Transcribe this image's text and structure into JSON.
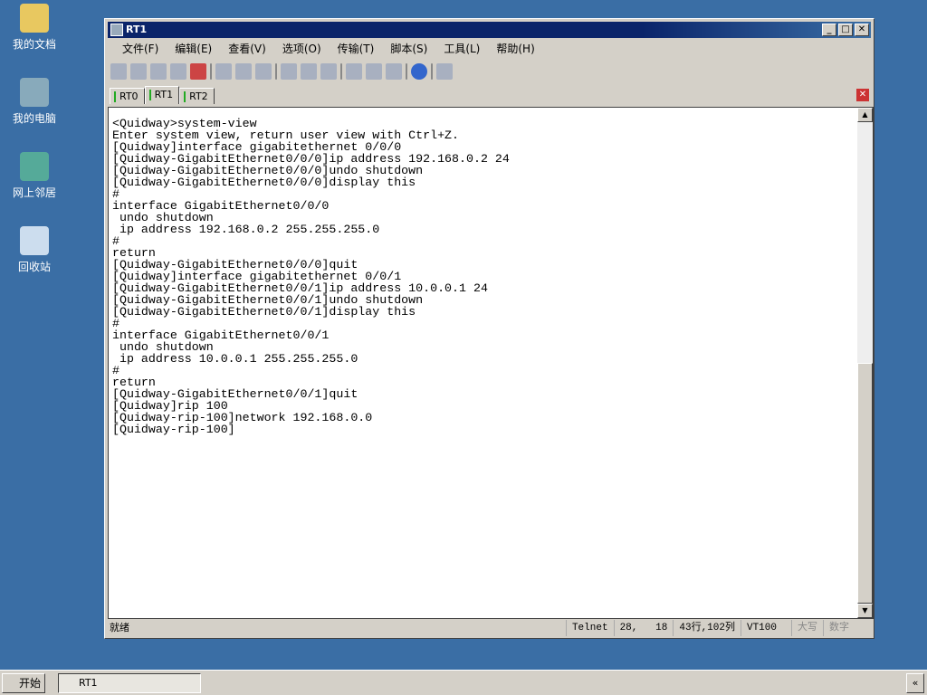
{
  "desktop": {
    "icons": [
      {
        "label": "我的文档"
      },
      {
        "label": "我的电脑"
      },
      {
        "label": "网上邻居"
      },
      {
        "label": "回收站"
      }
    ]
  },
  "window": {
    "title": "RT1",
    "menu": [
      "文件(F)",
      "编辑(E)",
      "查看(V)",
      "选项(O)",
      "传输(T)",
      "脚本(S)",
      "工具(L)",
      "帮助(H)"
    ],
    "tabs": [
      {
        "label": "RT0"
      },
      {
        "label": "RT1",
        "active": true
      },
      {
        "label": "RT2"
      }
    ],
    "terminal": "<Quidway>system-view\nEnter system view, return user view with Ctrl+Z.\n[Quidway]interface gigabitethernet 0/0/0\n[Quidway-GigabitEthernet0/0/0]ip address 192.168.0.2 24\n[Quidway-GigabitEthernet0/0/0]undo shutdown\n[Quidway-GigabitEthernet0/0/0]display this\n#\ninterface GigabitEthernet0/0/0\n undo shutdown\n ip address 192.168.0.2 255.255.255.0\n#\nreturn\n[Quidway-GigabitEthernet0/0/0]quit\n[Quidway]interface gigabitethernet 0/0/1\n[Quidway-GigabitEthernet0/0/1]ip address 10.0.0.1 24\n[Quidway-GigabitEthernet0/0/1]undo shutdown\n[Quidway-GigabitEthernet0/0/1]display this\n#\ninterface GigabitEthernet0/0/1\n undo shutdown\n ip address 10.0.0.1 255.255.255.0\n#\nreturn\n[Quidway-GigabitEthernet0/0/1]quit\n[Quidway]rip 100\n[Quidway-rip-100]network 192.168.0.0\n[Quidway-rip-100]",
    "status": {
      "ready": "就绪",
      "protocol": "Telnet",
      "cursor": "28,   18",
      "size": "43行,102列",
      "emulation": "VT100",
      "caps": "大写",
      "num": "数字"
    }
  },
  "taskbar": {
    "start": "开始",
    "task": "RT1",
    "tray": "«"
  }
}
